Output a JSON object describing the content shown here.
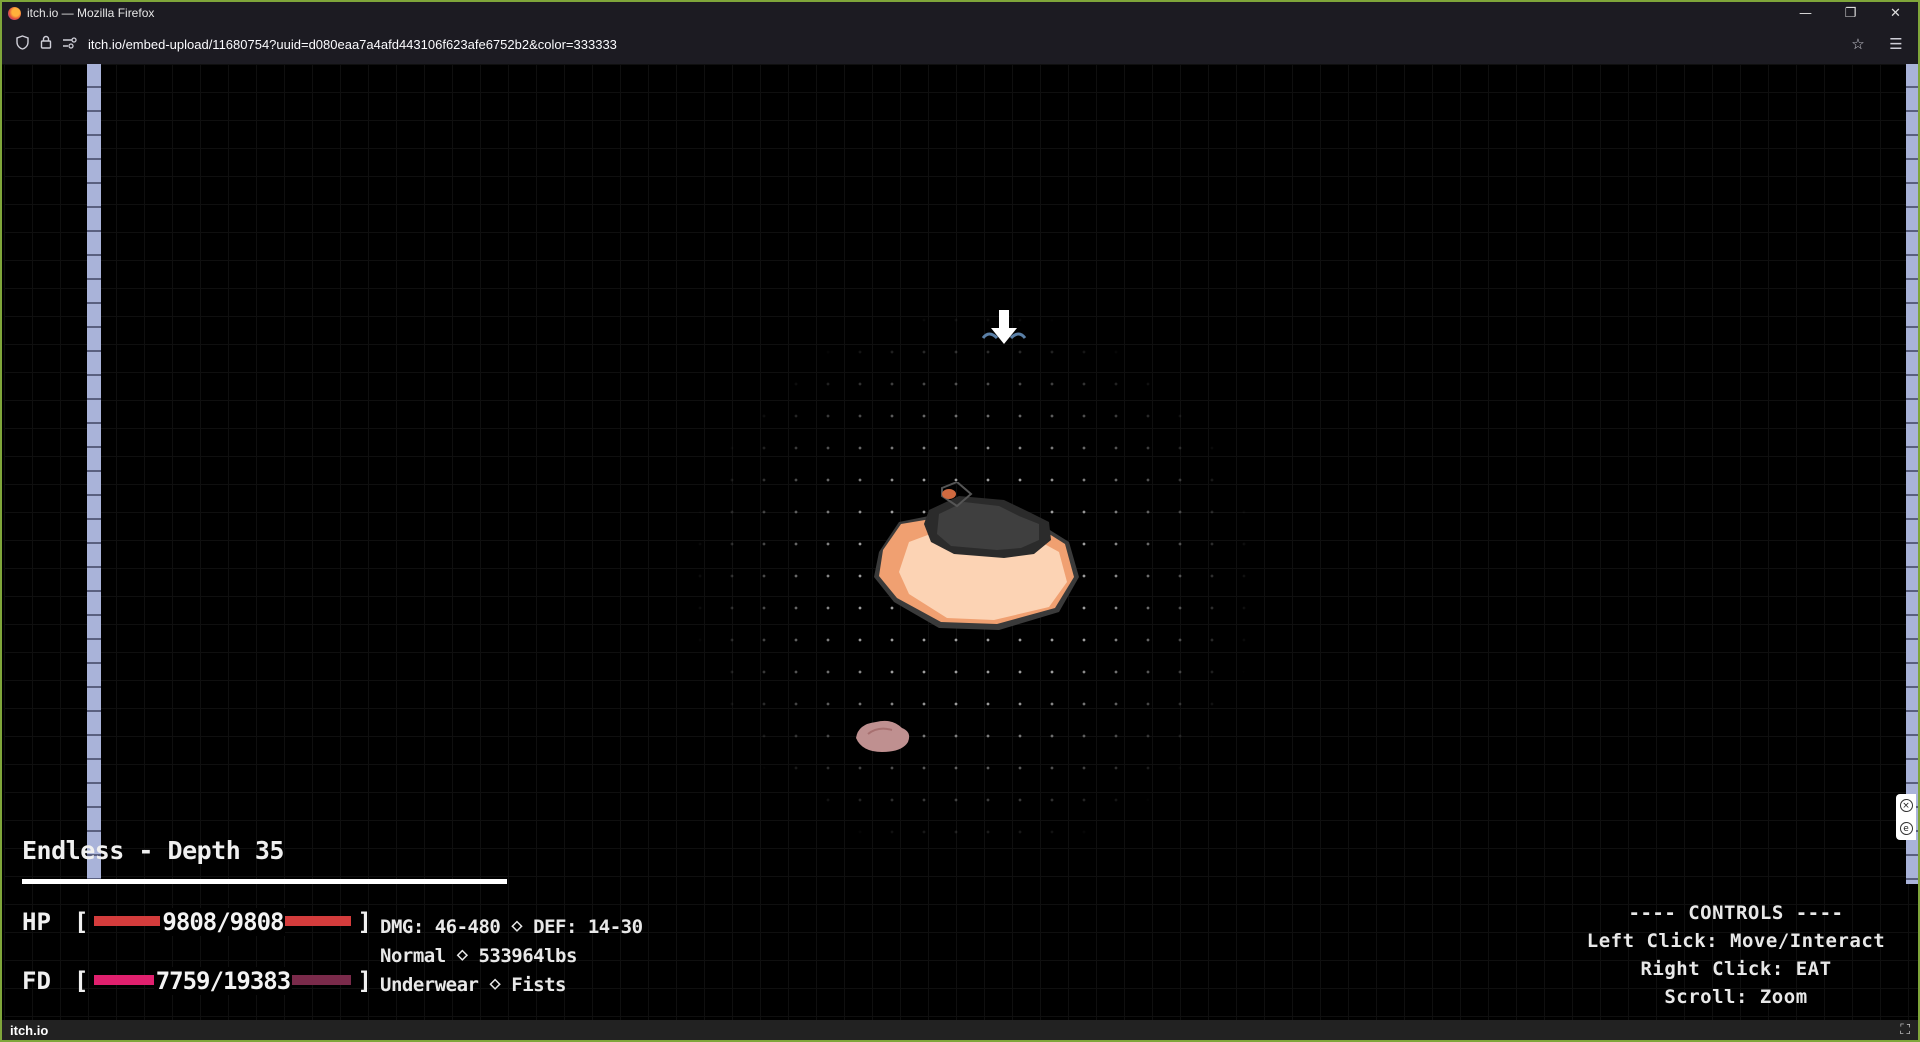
{
  "window": {
    "title": "itch.io — Mozilla Firefox",
    "min_icon": "minimize-icon",
    "restore_icon": "restore-icon",
    "close_icon": "close-icon"
  },
  "navbar": {
    "url": "itch.io/embed-upload/11680754?uuid=d080eaa7a4afd443106f623afe6752b2&color=333333"
  },
  "game": {
    "mode_title": "Endless - Depth 35",
    "hp": {
      "label": "HP",
      "value": "9808/9808",
      "fraction": 1.0,
      "color": "#d43c3c"
    },
    "fd": {
      "label": "FD",
      "value": "7759/19383",
      "fraction": 0.4,
      "color": "#e0206e",
      "track_color": "#7a2a4a"
    },
    "stats": {
      "line1": "DMG: 46-480 ⋄ DEF: 14-30",
      "line2": "Normal ⋄ 533964lbs",
      "line3": "Underwear ⋄ Fists"
    },
    "controls": {
      "header": "---- CONTROLS ----",
      "left": "Left Click: Move/Interact",
      "right": "Right Click: EAT",
      "scroll": "Scroll: Zoom"
    }
  },
  "bottombar": {
    "brand": "itch.io"
  },
  "colors": {
    "border": "#7fa63a",
    "wall": "#a9b3d9"
  }
}
